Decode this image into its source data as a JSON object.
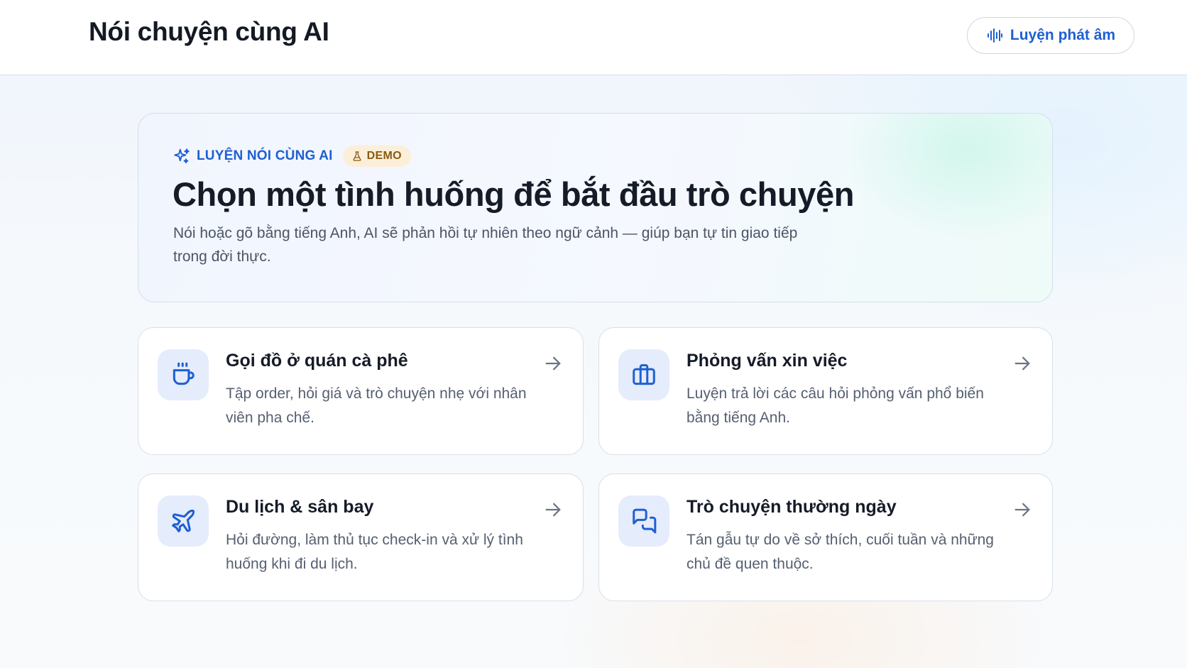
{
  "header": {
    "title": "Nói chuyện cùng AI",
    "pronunciation_button": {
      "label": "Luyện phát âm",
      "icon": "audio-waveform-icon"
    }
  },
  "hero": {
    "eyebrow": "LUYỆN NÓI CÙNG AI",
    "eyebrow_icon": "sparkles-icon",
    "badge": "DEMO",
    "badge_icon": "flask-icon",
    "title": "Chọn một tình huống để bắt đầu trò chuyện",
    "subtitle": "Nói hoặc gõ bằng tiếng Anh, AI sẽ phản hồi tự nhiên theo ngữ cảnh — giúp bạn tự tin giao tiếp trong đời thực."
  },
  "scenarios": [
    {
      "title": "Gọi đồ ở quán cà phê",
      "description": "Tập order, hỏi giá và trò chuyện nhẹ với nhân viên pha chế.",
      "icon": "coffee-cup-icon"
    },
    {
      "title": "Phỏng vấn xin việc",
      "description": "Luyện trả lời các câu hỏi phỏng vấn phổ biến bằng tiếng Anh.",
      "icon": "briefcase-icon"
    },
    {
      "title": "Du lịch & sân bay",
      "description": "Hỏi đường, làm thủ tục check-in và xử lý tình huống khi đi du lịch.",
      "icon": "airplane-icon"
    },
    {
      "title": "Trò chuyện thường ngày",
      "description": "Tán gẫu tự do về sở thích, cuối tuần và những chủ đề quen thuộc.",
      "icon": "chat-bubbles-icon"
    }
  ],
  "colors": {
    "accent": "#1f5fd1",
    "icon_tile_bg": "#e5ecfb",
    "badge_bg": "#fcefd9",
    "badge_text": "#8a5a12"
  }
}
